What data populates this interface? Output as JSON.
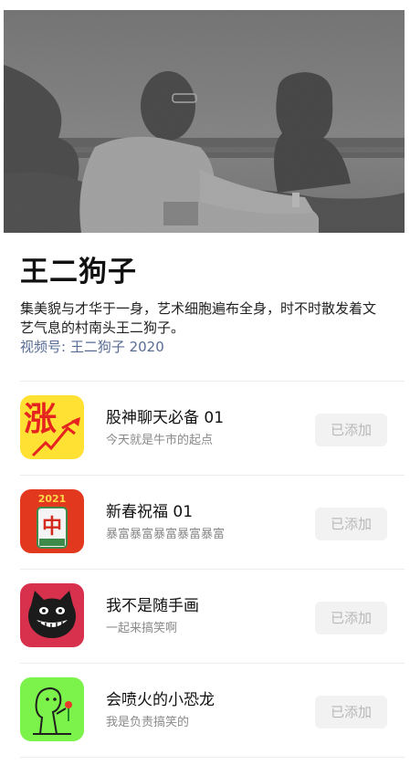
{
  "profile": {
    "name": "王二狗子",
    "bio": "集美貌与才华于一身，艺术细胞遍布全身，时不时散发着文艺气息的村南头王二狗子。",
    "channel_id": "视频号: 王二狗子 2020"
  },
  "stickers": [
    {
      "title": "股神聊天必备 01",
      "desc": "今天就是牛市的起点",
      "button_label": "已添加",
      "icon_text": "涨",
      "icon": "rising-stock-icon"
    },
    {
      "title": "新春祝福 01",
      "desc": "暴富暴富暴富暴富暴富",
      "button_label": "已添加",
      "icon_year": "2021",
      "icon_text": "中",
      "icon": "mahjong-tile-icon"
    },
    {
      "title": "我不是随手画",
      "desc": "一起来搞笑啊",
      "button_label": "已添加",
      "icon": "grinning-cat-icon"
    },
    {
      "title": "会喷火的小恐龙",
      "desc": "我是负责搞笑的",
      "button_label": "已添加",
      "icon": "dinosaur-icon"
    }
  ],
  "colors": {
    "accent_link": "#586c94",
    "sticker_1_bg": "#ffe133",
    "sticker_2_bg": "#e2381e",
    "sticker_3_bg": "#d7314d",
    "sticker_4_bg": "#7cf34a"
  }
}
